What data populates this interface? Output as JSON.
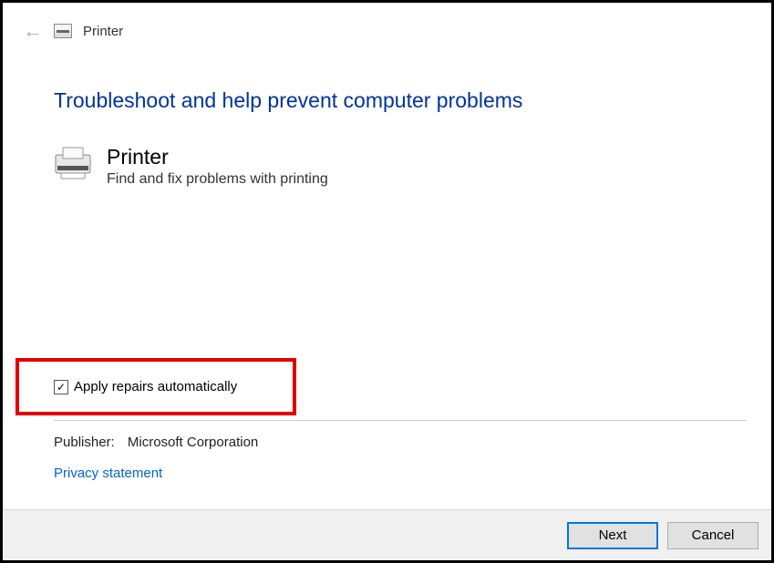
{
  "header": {
    "title": "Printer"
  },
  "main": {
    "heading": "Troubleshoot and help prevent computer problems",
    "item_title": "Printer",
    "item_description": "Find and fix problems with printing"
  },
  "checkbox": {
    "label": "Apply repairs automatically",
    "checked": true
  },
  "publisher": {
    "label": "Publisher:",
    "value": "Microsoft Corporation"
  },
  "links": {
    "privacy": "Privacy statement"
  },
  "buttons": {
    "next": "Next",
    "cancel": "Cancel"
  }
}
